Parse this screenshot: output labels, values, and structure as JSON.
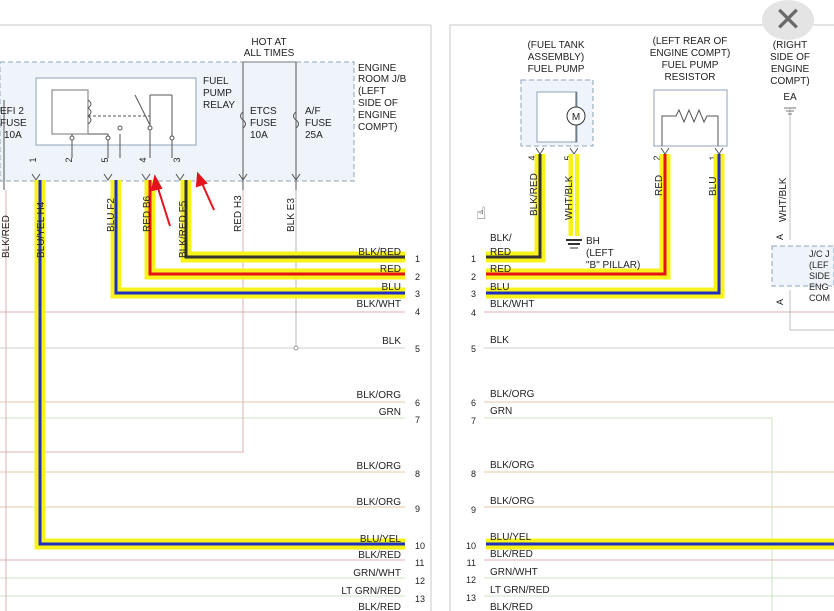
{
  "colors": {
    "highlight_yellow": "#f7f31a",
    "wire_red": "#e3121b",
    "wire_blue": "#1f2fc2",
    "wire_black": "#222222",
    "box_outline": "#7f96b0",
    "box_fill": "#e9f1f8",
    "faint_wire": "#dcb0b0",
    "faint_green": "#cfe3c4",
    "gray_line": "#9c9c9c"
  },
  "icons": {
    "close": "close-icon",
    "cursor": "hand-pointer-icon",
    "motor": "motor-icon",
    "resistor": "resistor-icon",
    "ground": "ground-icon"
  },
  "close_glyph": "✕",
  "cursor_glyph": "☝",
  "left_panel": {
    "hot_at": [
      "HOT AT",
      "ALL TIMES"
    ],
    "engine_room": [
      "ENGINE",
      "ROOM J/B",
      "(LEFT",
      "SIDE OF",
      "ENGINE",
      "COMPT)"
    ],
    "efi_fuse": [
      "EFI 2",
      "FUSE",
      "10A"
    ],
    "relay": [
      "FUEL",
      "PUMP",
      "RELAY"
    ],
    "etcs_fuse": [
      "ETCS",
      "FUSE",
      "10A"
    ],
    "af_fuse": [
      "A/F",
      "FUSE",
      "25A"
    ],
    "relay_pins": [
      "1",
      "2",
      "5",
      "4",
      "3"
    ],
    "wire_labels": {
      "blk_red_left": "BLK/RED",
      "blu_yel_h4": "BLU/YEL  H4",
      "blu_f2": "BLU  F2",
      "red_b6": "RED  B6",
      "blk_red_f5": "BLK/RED  F5",
      "red_h3": "RED  H3",
      "blk_e3": "BLK  E3"
    },
    "connector_rows": [
      {
        "label": "BLK/RED",
        "pin": "1"
      },
      {
        "label": "RED",
        "pin": "2"
      },
      {
        "label": "BLU",
        "pin": "3"
      },
      {
        "label": "BLK/WHT",
        "pin": "4"
      },
      {
        "label": "BLK",
        "pin": "5"
      },
      {
        "label": "BLK/ORG",
        "pin": "6"
      },
      {
        "label": "GRN",
        "pin": "7"
      },
      {
        "label": "BLK/ORG",
        "pin": "8"
      },
      {
        "label": "BLK/ORG",
        "pin": "9"
      },
      {
        "label": "BLU/YEL",
        "pin": "10"
      },
      {
        "label": "BLK/RED",
        "pin": "11"
      },
      {
        "label": "GRN/WHT",
        "pin": "12"
      },
      {
        "label": "LT GRN/RED",
        "pin": "13"
      },
      {
        "label": "BLK/RED",
        "pin": ""
      }
    ]
  },
  "right_panel": {
    "fuel_tank": [
      "(FUEL TANK",
      "ASSEMBLY)",
      "FUEL PUMP"
    ],
    "resistor": [
      "(LEFT REAR OF",
      "ENGINE COMPT)",
      "FUEL PUMP",
      "RESISTOR"
    ],
    "right_side": [
      "(RIGHT",
      "SIDE OF",
      "ENGINE",
      "COMPT)",
      "EA"
    ],
    "motor_symbol": "M",
    "pump_pins": [
      "4",
      "5"
    ],
    "resistor_pins": [
      "2",
      "1"
    ],
    "wire_labels": {
      "blk_red": "BLK/RED",
      "wht_blk": "WHT/BLK",
      "red": "RED",
      "blu": "BLU",
      "wht_blk_right": "WHT/BLK"
    },
    "bh_label": [
      "BH",
      "(LEFT",
      "\"B\" PILLAR)"
    ],
    "jc_label": [
      "J/C J",
      "(LEF",
      "SIDE",
      "ENG",
      "COM"
    ],
    "jc_pins": [
      "A",
      "A"
    ],
    "connector_rows": [
      {
        "label": "BLK/",
        "pin": ""
      },
      {
        "label": "RED",
        "pin": "1"
      },
      {
        "label": "RED",
        "pin": "2"
      },
      {
        "label": "BLU",
        "pin": "3"
      },
      {
        "label": "BLK/WHT",
        "pin": "4"
      },
      {
        "label": "BLK",
        "pin": "5"
      },
      {
        "label": "BLK/ORG",
        "pin": "6"
      },
      {
        "label": "GRN",
        "pin": "7"
      },
      {
        "label": "BLK/ORG",
        "pin": "8"
      },
      {
        "label": "BLK/ORG",
        "pin": "9"
      },
      {
        "label": "BLU/YEL",
        "pin": "10"
      },
      {
        "label": "BLK/RED",
        "pin": "11"
      },
      {
        "label": "GRN/WHT",
        "pin": "12"
      },
      {
        "label": "LT GRN/RED",
        "pin": "13"
      },
      {
        "label": "BLK/RED",
        "pin": ""
      }
    ]
  }
}
